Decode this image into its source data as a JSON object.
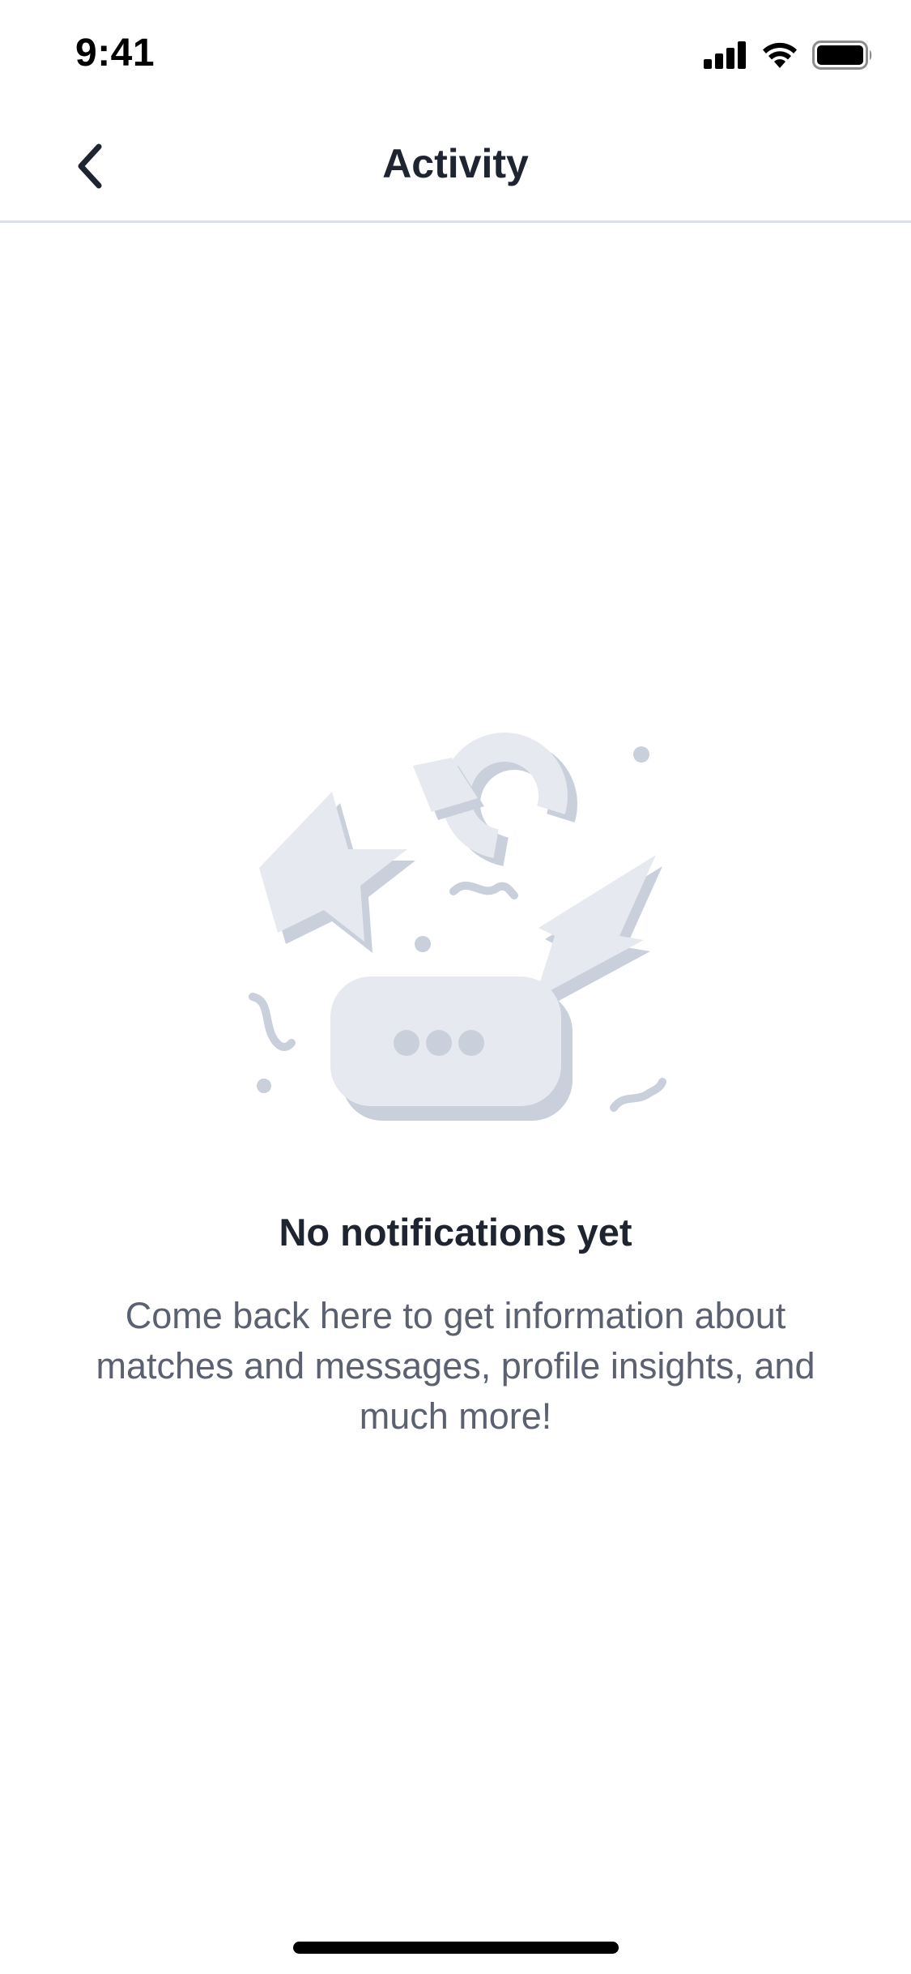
{
  "status_bar": {
    "time": "9:41",
    "icons": [
      "cellular-signal-icon",
      "wifi-icon",
      "battery-icon"
    ]
  },
  "nav": {
    "title": "Activity",
    "back_icon": "chevron-left-icon"
  },
  "empty_state": {
    "illustration": "notification-confetti-illustration",
    "title": "No notifications yet",
    "body": "Come back here to get information about matches and messages, profile insights, and much more!"
  },
  "colors": {
    "title_text": "#1e2430",
    "body_text": "#5b6170",
    "illustration_light": "#e6e9f0",
    "illustration_dark": "#c9d0dc",
    "divider": "#dcdfe4"
  }
}
